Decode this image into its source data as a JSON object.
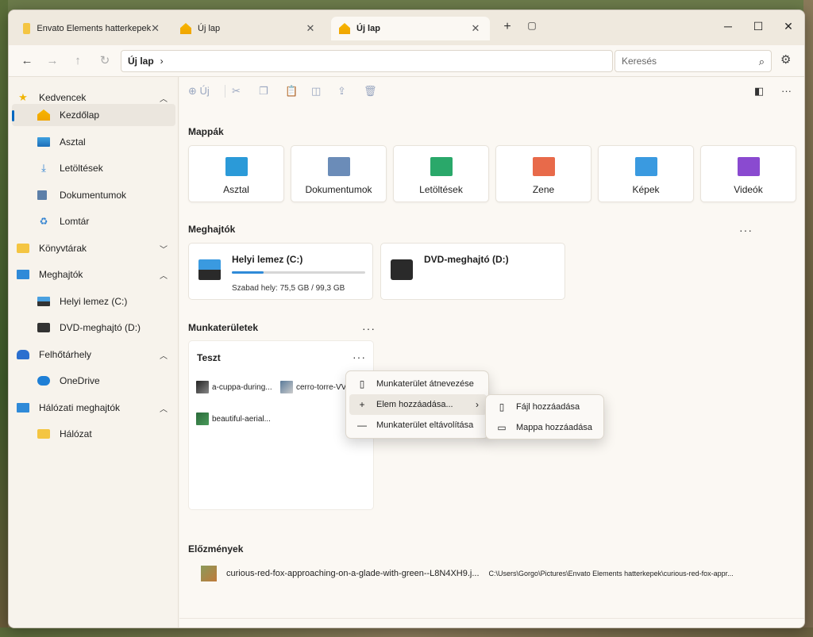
{
  "tabs": [
    {
      "label": "Envato Elements hatterkepek",
      "icon": "folder-icon"
    },
    {
      "label": "Új lap",
      "icon": "home-icon"
    },
    {
      "label": "Új lap",
      "icon": "home-icon"
    }
  ],
  "window_controls": {
    "new_tab": "+",
    "minimize": "─",
    "maximize": "☐",
    "close": "✕"
  },
  "navbar": {
    "breadcrumb": "Új lap",
    "search_placeholder": "Keresés"
  },
  "sidebar": {
    "items": [
      {
        "label": "Kedvencek"
      },
      {
        "label": "Kezdőlap"
      },
      {
        "label": "Asztal"
      },
      {
        "label": "Letöltések"
      },
      {
        "label": "Dokumentumok"
      },
      {
        "label": "Lomtár"
      },
      {
        "label": "Könyvtárak"
      },
      {
        "label": "Meghajtók"
      },
      {
        "label": "Helyi lemez (C:)"
      },
      {
        "label": "DVD-meghajtó (D:)"
      },
      {
        "label": "Felhőtárhely"
      },
      {
        "label": "OneDrive"
      },
      {
        "label": "Hálózati meghajtók"
      },
      {
        "label": "Hálózat"
      }
    ]
  },
  "toolbar": {
    "new_label": "Új"
  },
  "sections": {
    "folders_title": "Mappák",
    "drives_title": "Meghajtók",
    "workspaces_title": "Munkaterületek",
    "history_title": "Előzmények"
  },
  "folders": [
    {
      "label": "Asztal",
      "color": "#2b9ad8"
    },
    {
      "label": "Dokumentumok",
      "color": "#6b8cb8"
    },
    {
      "label": "Letöltések",
      "color": "#2aa86a"
    },
    {
      "label": "Zene",
      "color": "#e86a4a"
    },
    {
      "label": "Képek",
      "color": "#3a9ae0"
    },
    {
      "label": "Videók",
      "color": "#8a4ad0"
    }
  ],
  "drives": [
    {
      "name": "Helyi lemez (C:)",
      "free": "Szabad hely: 75,5 GB / 99,3 GB",
      "used_fraction": 0.24
    },
    {
      "name": "DVD-meghajtó (D:)"
    }
  ],
  "workspace": {
    "title": "Teszt",
    "items": [
      {
        "label": "a-cuppa-during..."
      },
      {
        "label": "cerro-torre-VV"
      },
      {
        "label": "beautiful-aerial..."
      }
    ]
  },
  "context_menu": {
    "items": [
      {
        "label": "Munkaterület átnevezése"
      },
      {
        "label": "Elem hozzáadása..."
      },
      {
        "label": "Munkaterület eltávolítása"
      }
    ]
  },
  "submenu": {
    "items": [
      {
        "label": "Fájl hozzáadása"
      },
      {
        "label": "Mappa hozzáadása"
      }
    ]
  },
  "history": {
    "file": "curious-red-fox-approaching-on-a-glade-with-green--L8N4XH9.j...",
    "path": "C:\\Users\\Gorgo\\Pictures\\Envato Elements hatterkepek\\curious-red-fox-appr..."
  }
}
